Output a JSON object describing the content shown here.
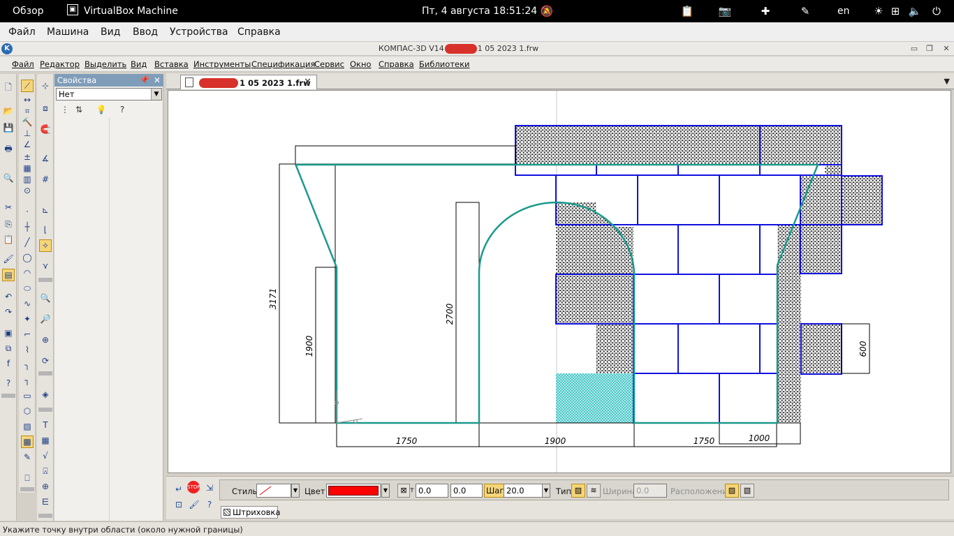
{
  "topbar": {
    "overview": "Обзор",
    "app_name": "VirtualBox Machine",
    "datetime": "Пт, 4 августа  18:51:24",
    "language": "en"
  },
  "vbox_menu": [
    "Файл",
    "Машина",
    "Вид",
    "Ввод",
    "Устройства",
    "Справка"
  ],
  "kompas": {
    "title_prefix": "КОМПАС-3D V14",
    "title_suffix": "1 05 2023 1.frw",
    "menu": [
      "Файл",
      "Редактор",
      "Выделить",
      "Вид",
      "Вставка",
      "Инструменты",
      "Спецификация",
      "Сервис",
      "Окно",
      "Справка",
      "Библиотеки"
    ],
    "doc_tab_name": "1 05 2023 1.frw"
  },
  "properties": {
    "title": "Свойства",
    "selector_value": "Нет"
  },
  "drawing": {
    "dims": [
      "3171",
      "1900",
      "2700",
      "600",
      "1750",
      "1900",
      "1750",
      "1000"
    ],
    "colors": {
      "outline": "#1a9a8c",
      "masonry": "#1010e0",
      "dim_lines": "#000000"
    }
  },
  "hatch_bar": {
    "style_label": "Стиль",
    "color_label": "Цвет",
    "color_value": "#ff0000",
    "t_label": "т",
    "x_value": "0.0",
    "y_value": "0.0",
    "step_label": "Шаг",
    "step_value": "20.0",
    "type_label": "Тип",
    "width_label": "Ширина",
    "width_value": "0.0",
    "position_label": "Расположение",
    "tab_label": "Штриховка"
  },
  "status": "Укажите точку внутри области (около нужной границы)"
}
